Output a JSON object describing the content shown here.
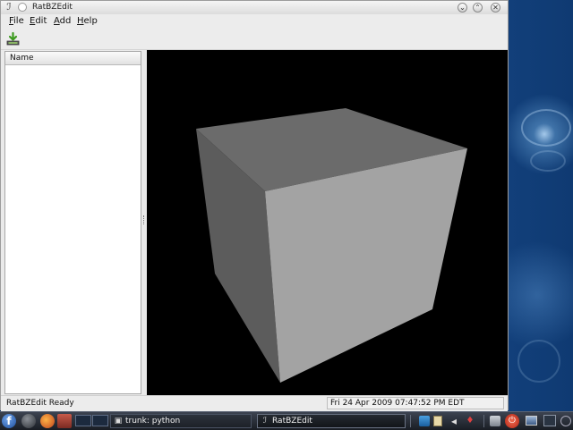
{
  "window": {
    "title": "RatBZEdit",
    "controls": {
      "minimize": "⌄",
      "maximize": "⌃",
      "close": "✕"
    }
  },
  "menubar": {
    "items": [
      {
        "label_ul": "F",
        "label_rest": "ile"
      },
      {
        "label_ul": "E",
        "label_rest": "dit"
      },
      {
        "label_ul": "A",
        "label_rest": "dd"
      },
      {
        "label_ul": "H",
        "label_rest": "elp"
      }
    ]
  },
  "toolbar": {
    "save_icon": "save-download-icon"
  },
  "tree": {
    "header": "Name"
  },
  "viewport": {
    "scene": "cube",
    "colors": {
      "background": "#000000",
      "top_face": "#6b6b6b",
      "left_face": "#5c5c5c",
      "front_face": "#a3a3a3"
    }
  },
  "statusbar": {
    "message": "RatBZEdit Ready",
    "datetime": "Fri 24 Apr 2009 07:47:52 PM EDT"
  },
  "taskbar": {
    "tasks": [
      {
        "label": "trunk: python",
        "icon": "terminal-icon"
      },
      {
        "label": "RatBZEdit",
        "icon": "app-icon"
      }
    ],
    "tray_icons": [
      "network-icon",
      "clipboard-icon",
      "volume-icon",
      "update-icon",
      "power-icon",
      "display-icon",
      "clock-icon"
    ]
  },
  "colors": {
    "accent_power": "#d83a2a",
    "taskbar": "#1d2128",
    "window_bg": "#ececec"
  }
}
